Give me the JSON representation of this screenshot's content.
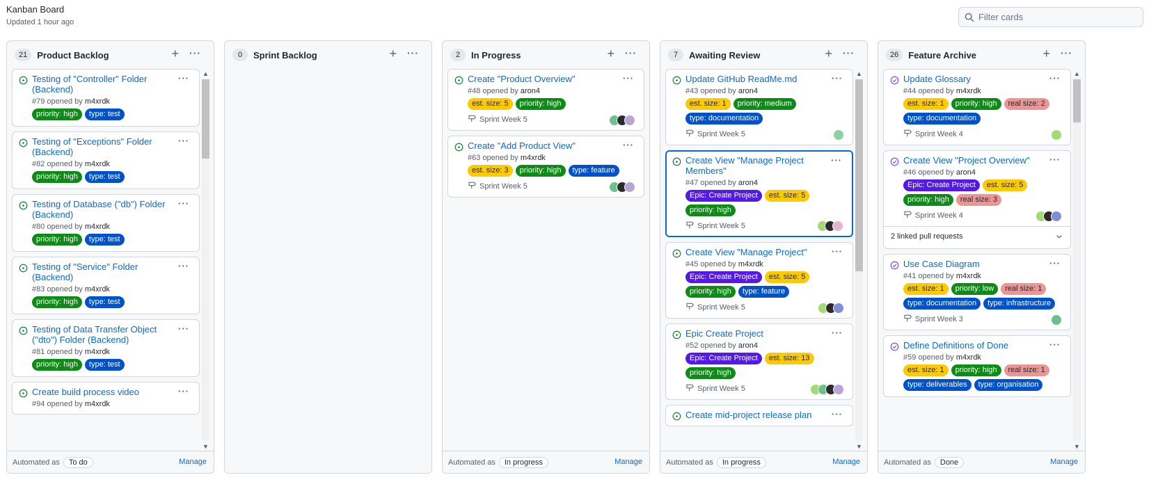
{
  "board": {
    "title": "Kanban Board",
    "updated": "Updated 1 hour ago"
  },
  "filter": {
    "placeholder": "Filter cards",
    "value": ""
  },
  "colors": {
    "open": "#1a7f37",
    "closed": "#8250df",
    "link": "#0969da",
    "selected_border": "#0969da",
    "labels": {
      "priority": {
        "bg": "#0e8a16",
        "fg": "#ffffff"
      },
      "type": {
        "bg": "#0052cc",
        "fg": "#ffffff"
      },
      "est": {
        "bg": "#fbca04",
        "fg": "#24292f"
      },
      "real": {
        "bg": "#e99695",
        "fg": "#24292f"
      },
      "epic": {
        "bg": "#5319e7",
        "fg": "#ffffff"
      }
    }
  },
  "icons": {
    "add": "plus-icon",
    "more": "kebab-horizontal-icon",
    "open_issue": "issue-opened-icon",
    "closed_issue": "issue-closed-icon",
    "milestone": "milestone-icon",
    "search": "search-icon",
    "chevron": "chevron-down-icon"
  },
  "columns": [
    {
      "name": "Product Backlog",
      "count": "21",
      "automated_label": "Automated as",
      "automated": "To do",
      "manage": "Manage",
      "scroll": {
        "thumb_position": 0.0,
        "thumb_fraction": 0.22
      },
      "cards": [
        {
          "title": "Testing of \"Controller\" Folder (Backend)",
          "number": "#79",
          "opened": "opened by",
          "author": "m4xrdk",
          "state": "open",
          "labels": [
            {
              "text": "priority: high",
              "kind": "priority"
            },
            {
              "text": "type: test",
              "kind": "type"
            }
          ]
        },
        {
          "title": "Testing of \"Exceptions\" Folder (Backend)",
          "number": "#82",
          "opened": "opened by",
          "author": "m4xrdk",
          "state": "open",
          "labels": [
            {
              "text": "priority: high",
              "kind": "priority"
            },
            {
              "text": "type: test",
              "kind": "type"
            }
          ]
        },
        {
          "title": "Testing of Database (\"db\") Folder (Backend)",
          "number": "#80",
          "opened": "opened by",
          "author": "m4xrdk",
          "state": "open",
          "labels": [
            {
              "text": "priority: high",
              "kind": "priority"
            },
            {
              "text": "type: test",
              "kind": "type"
            }
          ]
        },
        {
          "title": "Testing of \"Service\" Folder (Backend)",
          "number": "#83",
          "opened": "opened by",
          "author": "m4xrdk",
          "state": "open",
          "labels": [
            {
              "text": "priority: high",
              "kind": "priority"
            },
            {
              "text": "type: test",
              "kind": "type"
            }
          ]
        },
        {
          "title": "Testing of Data Transfer Object (\"dto\") Folder (Backend)",
          "number": "#81",
          "opened": "opened by",
          "author": "m4xrdk",
          "state": "open",
          "labels": [
            {
              "text": "priority: high",
              "kind": "priority"
            },
            {
              "text": "type: test",
              "kind": "type"
            }
          ]
        },
        {
          "title": "Create build process video",
          "number": "#94",
          "opened": "opened by",
          "author": "m4xrdk",
          "state": "open",
          "labels": []
        }
      ]
    },
    {
      "name": "Sprint Backlog",
      "count": "0",
      "cards": []
    },
    {
      "name": "In Progress",
      "count": "2",
      "automated_label": "Automated as",
      "automated": "In progress",
      "manage": "Manage",
      "cards": [
        {
          "title": "Create \"Product Overview\"",
          "number": "#48",
          "opened": "opened by",
          "author": "aron4",
          "state": "open",
          "labels": [
            {
              "text": "est. size: 5",
              "kind": "est"
            },
            {
              "text": "priority: high",
              "kind": "priority"
            }
          ],
          "milestone": "Sprint Week 5",
          "avatars": [
            "#6cc08b",
            "#2b2b2b",
            "#b9a6d6"
          ]
        },
        {
          "title": "Create \"Add Product View\"",
          "number": "#63",
          "opened": "opened by",
          "author": "m4xrdk",
          "state": "open",
          "labels": [
            {
              "text": "est. size: 3",
              "kind": "est"
            },
            {
              "text": "priority: high",
              "kind": "priority"
            },
            {
              "text": "type: feature",
              "kind": "type"
            }
          ],
          "milestone": "Sprint Week 5",
          "avatars": [
            "#6cc08b",
            "#2b2b2b",
            "#b9a6d6"
          ]
        }
      ]
    },
    {
      "name": "Awaiting Review",
      "count": "7",
      "automated_label": "Automated as",
      "automated": "In progress",
      "manage": "Manage",
      "scroll": {
        "thumb_position": 0.0,
        "thumb_fraction": 0.53
      },
      "cards": [
        {
          "title": "Update GitHub ReadMe.md",
          "number": "#43",
          "opened": "opened by",
          "author": "aron4",
          "state": "open",
          "labels": [
            {
              "text": "est. size: 1",
              "kind": "est"
            },
            {
              "text": "priority: medium",
              "kind": "priority"
            },
            {
              "text": "type: documentation",
              "kind": "type"
            }
          ],
          "milestone": "Sprint Week 5",
          "avatars": [
            "#8fd19e"
          ]
        },
        {
          "title": "Create View \"Manage Project Members\"",
          "number": "#47",
          "opened": "opened by",
          "author": "aron4",
          "state": "open",
          "selected": true,
          "labels": [
            {
              "text": "Epic: Create Project",
              "kind": "epic"
            },
            {
              "text": "est. size: 5",
              "kind": "est"
            },
            {
              "text": "priority: high",
              "kind": "priority"
            }
          ],
          "milestone": "Sprint Week 5",
          "avatars": [
            "#a3d977",
            "#2b2b2b",
            "#e7b3d1"
          ]
        },
        {
          "title": "Create View \"Manage Project\"",
          "number": "#45",
          "opened": "opened by",
          "author": "m4xrdk",
          "state": "open",
          "labels": [
            {
              "text": "Epic: Create Project",
              "kind": "epic"
            },
            {
              "text": "est. size: 5",
              "kind": "est"
            },
            {
              "text": "priority: high",
              "kind": "priority"
            },
            {
              "text": "type: feature",
              "kind": "type"
            }
          ],
          "milestone": "Sprint Week 5",
          "avatars": [
            "#a3d977",
            "#2b2b2b",
            "#7f8fd6"
          ]
        },
        {
          "title": "Epic Create Project",
          "number": "#52",
          "opened": "opened by",
          "author": "aron4",
          "state": "open",
          "labels": [
            {
              "text": "Epic: Create Project",
              "kind": "epic"
            },
            {
              "text": "est. size: 13",
              "kind": "est"
            },
            {
              "text": "priority: high",
              "kind": "priority"
            }
          ],
          "milestone": "Sprint Week 5",
          "avatars": [
            "#a3d977",
            "#6cc08b",
            "#2b2b2b",
            "#b9a6d6"
          ]
        },
        {
          "title": "Create mid-project release plan",
          "number": "",
          "opened": "",
          "author": "",
          "state": "open",
          "labels": []
        }
      ]
    },
    {
      "name": "Feature Archive",
      "count": "26",
      "automated_label": "Automated as",
      "automated": "Done",
      "manage": "Manage",
      "scroll": {
        "thumb_position": 0.0,
        "thumb_fraction": 0.12
      },
      "cards": [
        {
          "title": "Update Glossary",
          "number": "#44",
          "opened": "opened by",
          "author": "m4xrdk",
          "state": "closed",
          "labels": [
            {
              "text": "est. size: 1",
              "kind": "est"
            },
            {
              "text": "priority: high",
              "kind": "priority"
            },
            {
              "text": "real size: 2",
              "kind": "real"
            },
            {
              "text": "type: documentation",
              "kind": "type"
            }
          ],
          "milestone": "Sprint Week 4",
          "avatars": [
            "#a3d977"
          ]
        },
        {
          "title": "Create View \"Project Overview\"",
          "number": "#46",
          "opened": "opened by",
          "author": "aron4",
          "state": "closed",
          "labels": [
            {
              "text": "Epic: Create Project",
              "kind": "epic"
            },
            {
              "text": "est. size: 5",
              "kind": "est"
            },
            {
              "text": "priority: high",
              "kind": "priority"
            },
            {
              "text": "real size: 3",
              "kind": "real"
            }
          ],
          "milestone": "Sprint Week 4",
          "avatars": [
            "#a3d977",
            "#2b2b2b",
            "#7f8fd6"
          ],
          "linked": "2 linked pull requests"
        },
        {
          "title": "Use Case Diagram",
          "number": "#41",
          "opened": "opened by",
          "author": "m4xrdk",
          "state": "closed",
          "labels": [
            {
              "text": "est. size: 1",
              "kind": "est"
            },
            {
              "text": "priority: low",
              "kind": "priority"
            },
            {
              "text": "real size: 1",
              "kind": "real"
            },
            {
              "text": "type: documentation",
              "kind": "type"
            },
            {
              "text": "type: infrastructure",
              "kind": "type"
            }
          ],
          "milestone": "Sprint Week 3",
          "avatars": [
            "#6cc08b"
          ]
        },
        {
          "title": "Define Definitions of Done",
          "number": "#59",
          "opened": "opened by",
          "author": "m4xrdk",
          "state": "closed",
          "labels": [
            {
              "text": "est. size: 1",
              "kind": "est"
            },
            {
              "text": "priority: high",
              "kind": "priority"
            },
            {
              "text": "real size: 1",
              "kind": "real"
            },
            {
              "text": "type: deliverables",
              "kind": "type"
            },
            {
              "text": "type: organisation",
              "kind": "type"
            }
          ]
        }
      ]
    }
  ]
}
